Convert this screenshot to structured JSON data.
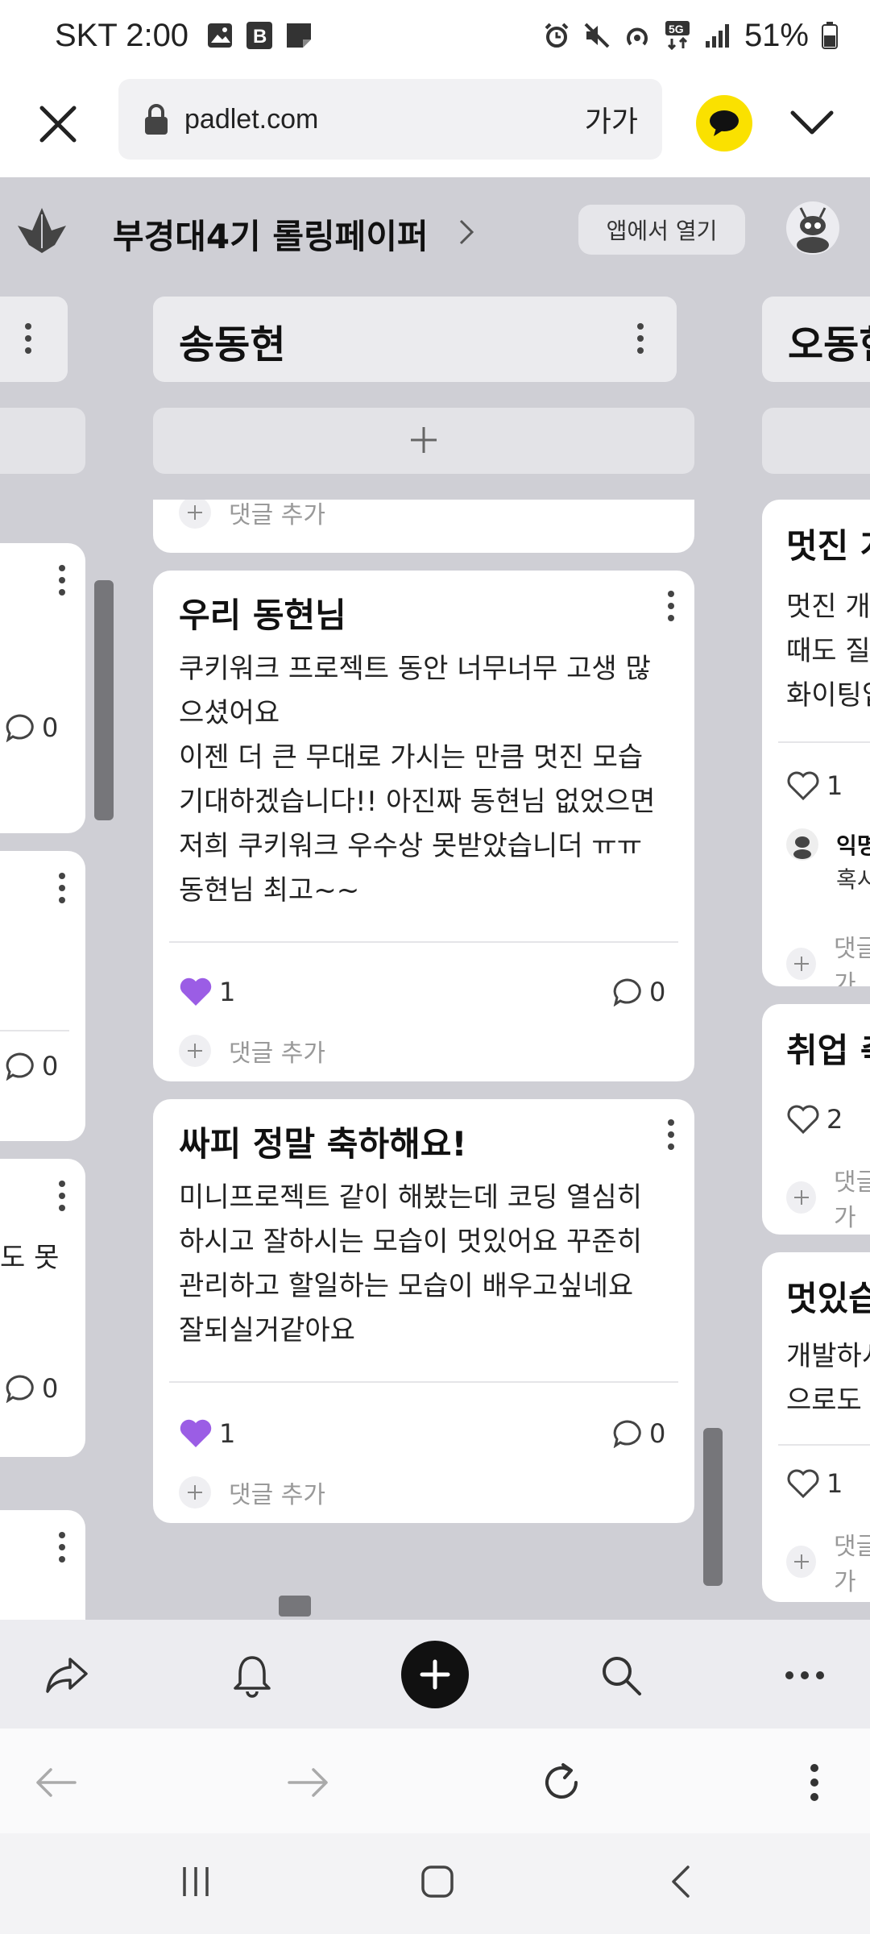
{
  "status_bar": {
    "carrier": "SKT",
    "time": "2:00",
    "battery": "51%",
    "network": "5G"
  },
  "browser": {
    "url": "padlet.com",
    "text_size": "가가"
  },
  "padlet": {
    "title": "부경대4기 롤링페이퍼",
    "open_in_app": "앱에서 열기",
    "columns": {
      "center": {
        "name": "송동현"
      },
      "right": {
        "name": "오동현"
      }
    },
    "add_comment": "댓글 추가",
    "cards": {
      "top_partial": {
        "add_comment": "댓글 추가"
      },
      "card1": {
        "title": "우리 동현님",
        "body_lines": [
          "쿠키워크 프로젝트 동안 너무너무 고생 많",
          "으셨어요",
          "이젠 더 큰 무대로 가시는 만큼 멋진 모습",
          "기대하겠습니다!! 아진짜 동현님 없었으면",
          "저희 쿠키워크 우수상 못받았습니더 ㅠㅠ",
          "동현님 최고~~"
        ],
        "likes": "1",
        "comments": "0"
      },
      "card2": {
        "title": "싸피 정말 축하해요!",
        "body_lines": [
          "미니프로젝트 같이 해봤는데 코딩 열심히",
          "하시고 잘하시는 모습이 멋있어요 꾸준히",
          "관리하고 할일하는 모습이 배우고싶네요",
          "잘되실거같아요"
        ],
        "likes": "1",
        "comments": "0"
      }
    },
    "left_column": {
      "comments": [
        "0",
        "0",
        "0"
      ],
      "partial_text": "도 못"
    },
    "right_column": {
      "card1": {
        "title": "멋진 개",
        "body_lines": [
          "멋진 개",
          "때도 질",
          "화이팅입"
        ],
        "likes": "1",
        "commenter": "익명",
        "comment_text": "혹시"
      },
      "card2": {
        "title": "취업 축",
        "likes": "2"
      },
      "card3": {
        "title": "멋있습",
        "body_lines": [
          "개발하시",
          "으로도"
        ],
        "likes": "1"
      }
    },
    "colors": {
      "background": "#cfcfd5",
      "like_active": "#9b5de5",
      "kakao_yellow": "#fae100"
    }
  }
}
